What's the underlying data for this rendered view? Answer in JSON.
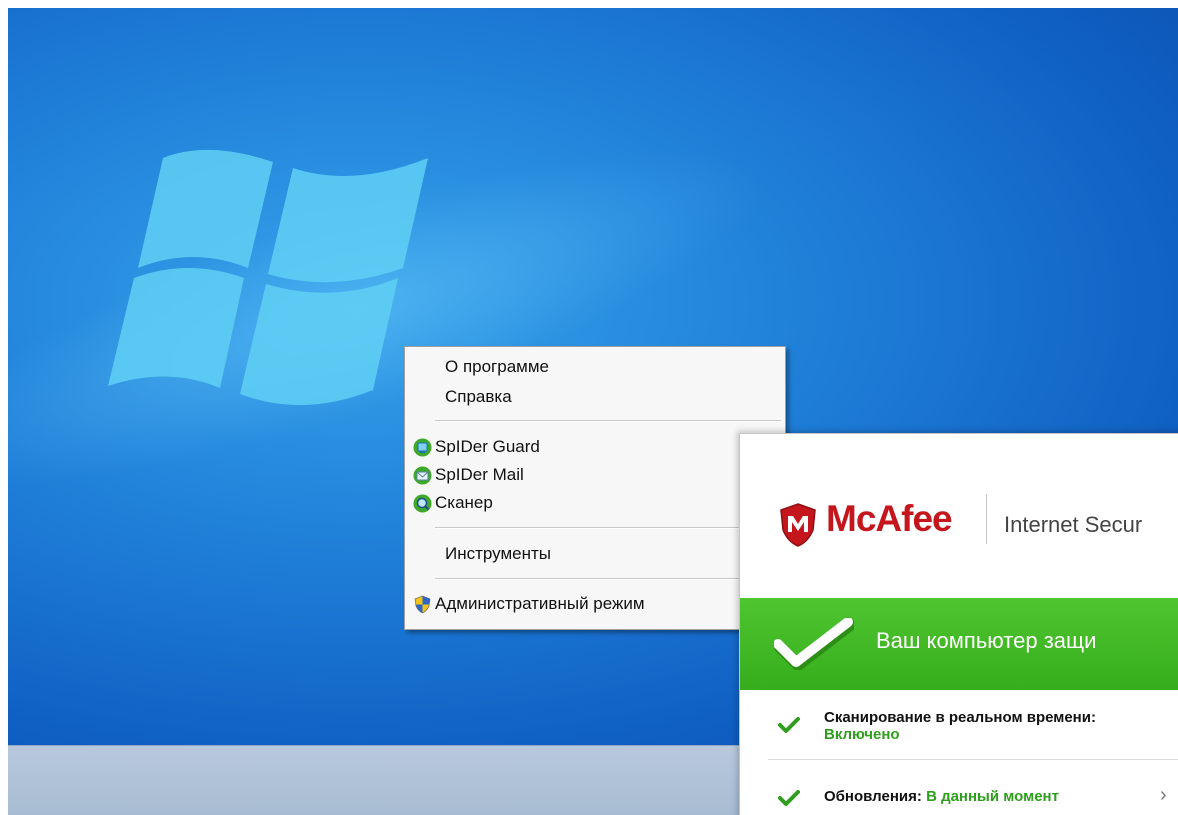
{
  "context_menu": {
    "items": [
      {
        "label": "О программе",
        "icon": null
      },
      {
        "label": "Справка",
        "icon": null
      },
      {
        "label": "SpIDer Guard",
        "icon": "spider-guard-icon"
      },
      {
        "label": "SpIDer Mail",
        "icon": "spider-mail-icon"
      },
      {
        "label": "Сканер",
        "icon": "scanner-icon"
      },
      {
        "label": "Инструменты",
        "icon": null
      },
      {
        "label": "Административный режим",
        "icon": "uac-shield-icon"
      }
    ]
  },
  "mcafee": {
    "brand": "McAfee",
    "product": "Internet Secur",
    "status_text": "Ваш компьютер защи",
    "realtime_label": "Сканирование в реальном времени:",
    "realtime_value": "Включено",
    "updates_label": "Обновления:",
    "updates_value": "В данный момент",
    "chevron": "›"
  },
  "colors": {
    "desktop_blue": "#1f7fd8",
    "mcafee_red": "#c4161c",
    "status_green": "#3fb824",
    "ok_green": "#2e9e1c"
  }
}
